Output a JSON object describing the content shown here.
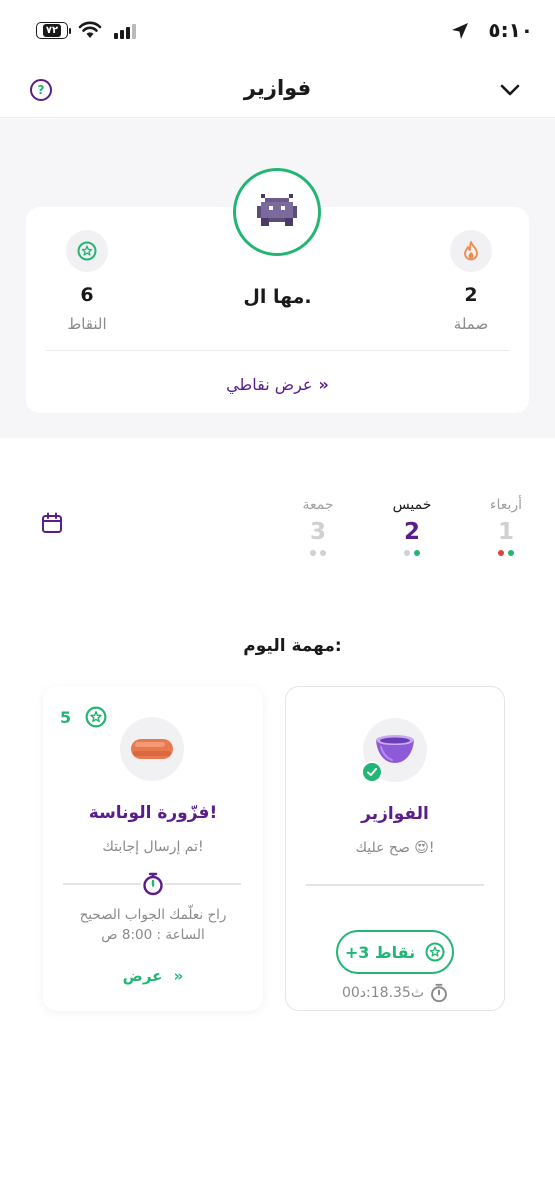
{
  "status_bar": {
    "time": "٥:١٠",
    "battery": "٧٢"
  },
  "header": {
    "title": "فوازير",
    "help_icon": "help-icon",
    "chevron_icon": "chevron-down-icon"
  },
  "profile": {
    "name": "مها ال.",
    "avatar_icon": "pixel-monster-icon",
    "streak": {
      "value": "2",
      "label": "صملة",
      "icon": "flame-icon"
    },
    "points": {
      "value": "6",
      "label": "النقاط",
      "icon": "star-badge-icon"
    },
    "view_points_label": "عرض نقاطي"
  },
  "days": [
    {
      "name": "جمعة",
      "number": "3",
      "dots": [
        "#cfcfd4",
        "#cfcfd4"
      ]
    },
    {
      "name": "خميس",
      "number": "2",
      "dots": [
        "#cfcfd4",
        "#22b573"
      ],
      "selected": true
    },
    {
      "name": "أربعاء",
      "number": "1",
      "dots": [
        "#e0403a",
        "#22b573"
      ]
    }
  ],
  "section_title": "مهمة اليوم:",
  "tasks": {
    "left": {
      "title": "فزّورة الوناسة!",
      "subtitle": "تم إرسال إجابتك!",
      "note_line1": "راح نعلّمك الجواب الصحيح",
      "note_line2": "الساعة : 8:00 ص",
      "link_label": "عرض",
      "points": "5"
    },
    "right": {
      "title": "الفوازير",
      "subtitle": "صح عليك 😍!",
      "points_label": "+3  نقاط",
      "elapsed": "ث18.35:د00"
    }
  },
  "colors": {
    "primary": "#5a1d8a",
    "accent": "#22b573",
    "flame": "#f08a4b"
  }
}
